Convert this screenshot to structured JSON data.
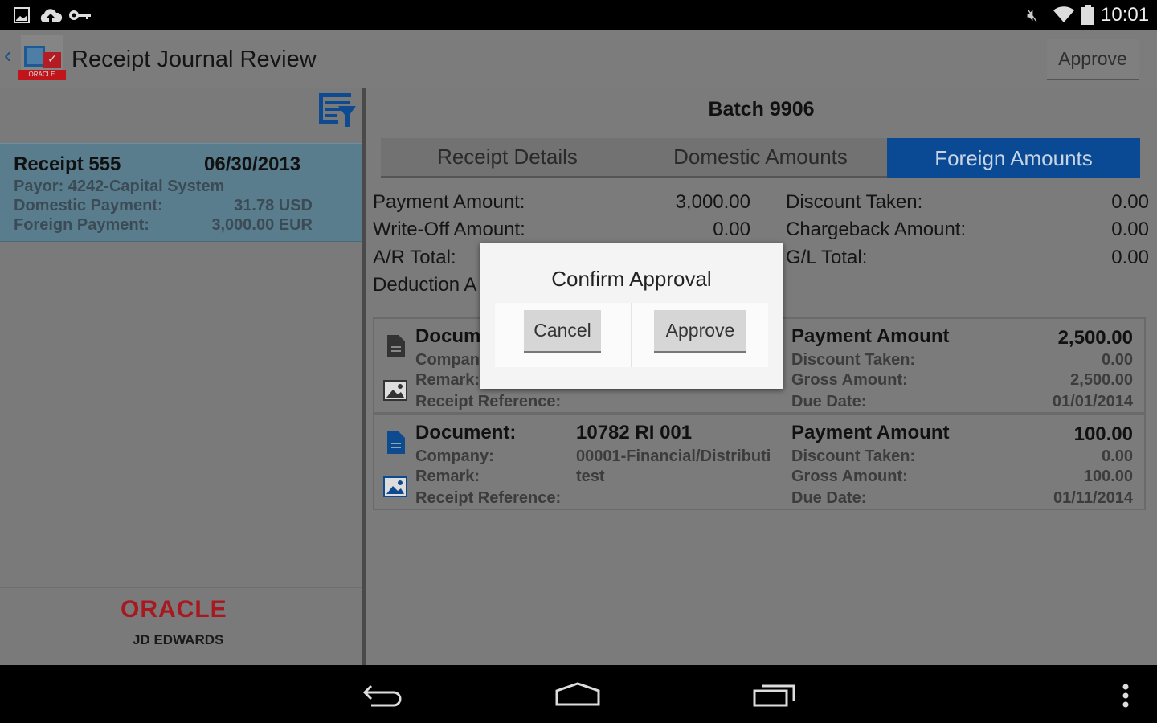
{
  "status_bar": {
    "time": "10:01",
    "icons": [
      "image-icon",
      "cloud-upload-icon",
      "key-icon",
      "mute-icon",
      "wifi-icon",
      "battery-icon"
    ]
  },
  "header": {
    "title": "Receipt Journal Review",
    "approve_label": "Approve",
    "logo_text": "ORACLE"
  },
  "left": {
    "receipt": {
      "title": "Receipt 555",
      "date": "06/30/2013",
      "payor": "Payor: 4242-Capital System",
      "domestic_label": "Domestic Payment:",
      "domestic_value": "31.78 USD",
      "foreign_label": "Foreign Payment:",
      "foreign_value": "3,000.00 EUR"
    },
    "brand": {
      "oracle": "ORACLE",
      "jde": "JD EDWARDS"
    }
  },
  "main": {
    "batch": "Batch 9906",
    "tabs": [
      {
        "label": "Receipt Details",
        "active": false
      },
      {
        "label": "Domestic Amounts",
        "active": false
      },
      {
        "label": "Foreign Amounts",
        "active": true
      }
    ],
    "summary_left": [
      {
        "label": "Payment Amount:",
        "value": "3,000.00"
      },
      {
        "label": "Write-Off Amount:",
        "value": "0.00"
      },
      {
        "label": "A/R Total:",
        "value": ""
      },
      {
        "label": "Deduction A",
        "value": ""
      }
    ],
    "summary_right": [
      {
        "label": "Discount Taken:",
        "value": "0.00"
      },
      {
        "label": "Chargeback Amount:",
        "value": "0.00"
      },
      {
        "label": "G/L Total:",
        "value": "0.00"
      }
    ],
    "documents": [
      {
        "doc_label": "Docum",
        "doc_value": "",
        "company_label": "Compan",
        "company_value": "",
        "remark_label": "Remark:",
        "remark_value": "",
        "ref_label": "Receipt Reference:",
        "pay_label": "Payment Amount",
        "pay_value": "2,500.00",
        "disc_label": "Discount Taken:",
        "disc_value": "0.00",
        "gross_label": "Gross Amount:",
        "gross_value": "2,500.00",
        "due_label": "Due Date:",
        "due_value": "01/01/2014"
      },
      {
        "doc_label": "Document:",
        "doc_value": "10782 RI 001",
        "company_label": "Company:",
        "company_value": "00001-Financial/Distributi",
        "remark_label": "Remark:",
        "remark_value": "test",
        "ref_label": "Receipt Reference:",
        "pay_label": "Payment Amount",
        "pay_value": "100.00",
        "disc_label": "Discount Taken:",
        "disc_value": "0.00",
        "gross_label": "Gross Amount:",
        "gross_value": "100.00",
        "due_label": "Due Date:",
        "due_value": "01/11/2014"
      }
    ]
  },
  "dialog": {
    "title": "Confirm Approval",
    "cancel": "Cancel",
    "approve": "Approve"
  },
  "colors": {
    "accent": "#0a4a94",
    "selected_row": "#5a7d8e",
    "oracle_red": "#c0151b"
  }
}
